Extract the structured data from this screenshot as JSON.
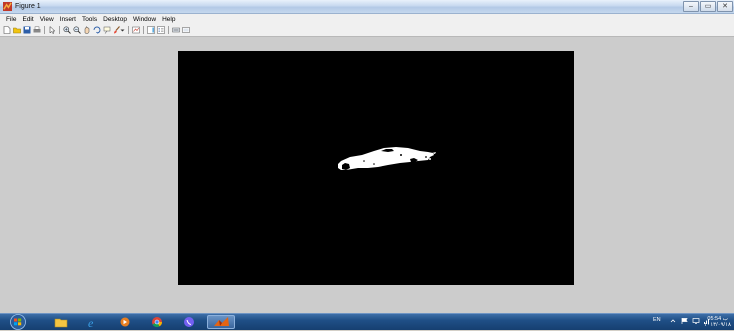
{
  "window": {
    "title": "Figure 1",
    "min_icon": "minimize-icon",
    "max_icon": "maximize-icon",
    "close_icon": "close-icon",
    "min_glyph": "–",
    "max_glyph": "▭",
    "close_glyph": "✕"
  },
  "menu": [
    "File",
    "Edit",
    "View",
    "Insert",
    "Tools",
    "Desktop",
    "Window",
    "Help"
  ],
  "toolbar": {
    "icons": [
      "new-figure-icon",
      "open-file-icon",
      "save-icon",
      "print-icon",
      "select-arrow-icon",
      "zoom-in-icon",
      "zoom-out-icon",
      "pan-icon",
      "rotate-3d-icon",
      "data-cursor-icon",
      "brush-icon",
      "link-plot-icon",
      "insert-colorbar-icon",
      "insert-legend-icon",
      "hide-plot-tools-icon",
      "show-plot-tools-icon"
    ]
  },
  "figure": {
    "background": "#cccccc",
    "axes_background": "#000000",
    "foreground": "#ffffff"
  },
  "taskbar": {
    "start_icon": "windows-start-icon",
    "apps": [
      "file-explorer-icon",
      "internet-explorer-icon",
      "media-player-icon",
      "chrome-icon",
      "viber-icon",
      "matlab-icon"
    ],
    "language": "EN",
    "tray_icons": [
      "show-hidden-icon",
      "flag-icon",
      "network-icon",
      "signal-icon"
    ],
    "time": "05:54 ب",
    "date": "۲۰۱۳/۰۹/۱۸"
  }
}
